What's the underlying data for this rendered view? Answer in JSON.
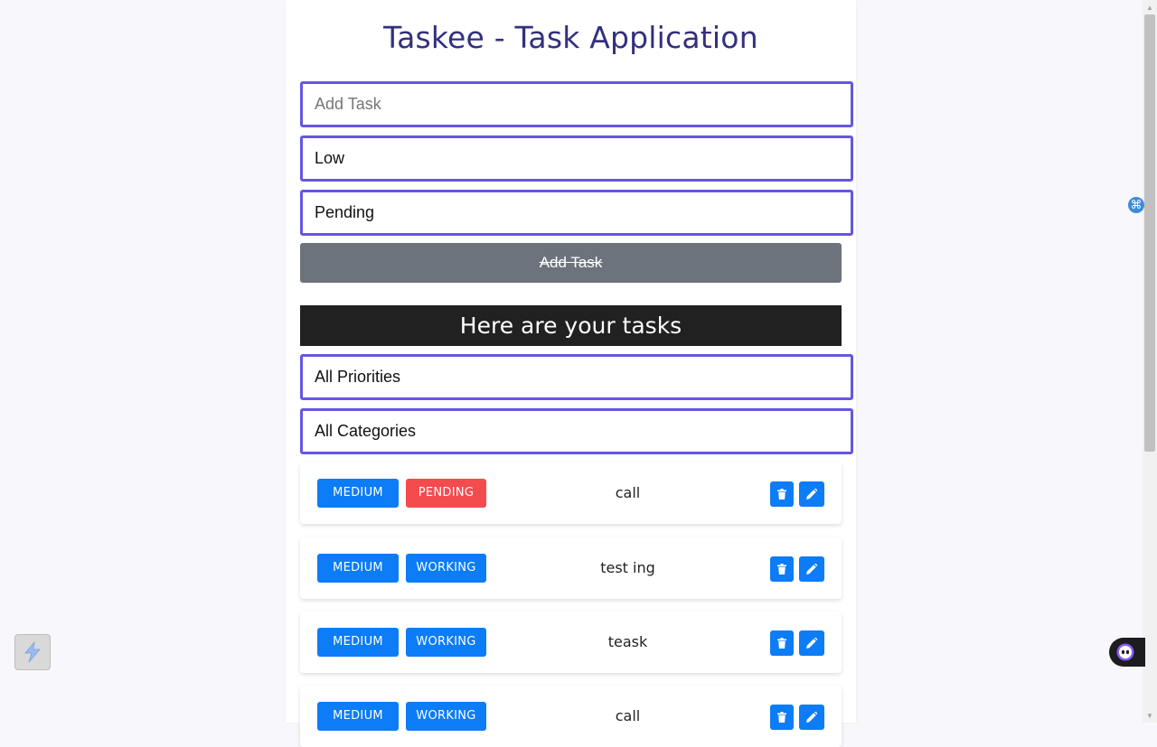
{
  "app": {
    "title": "Taskee - Task Application"
  },
  "form": {
    "task_placeholder": "Add Task",
    "task_value": "",
    "priority_value": "Low",
    "status_value": "Pending",
    "submit_label": "Add Task"
  },
  "list": {
    "header": "Here are your tasks",
    "priority_filter": "All Priorities",
    "category_filter": "All Categories"
  },
  "tasks": [
    {
      "priority": "MEDIUM",
      "status": "PENDING",
      "name": "call"
    },
    {
      "priority": "MEDIUM",
      "status": "WORKING",
      "name": "test ing"
    },
    {
      "priority": "MEDIUM",
      "status": "WORKING",
      "name": "teask"
    },
    {
      "priority": "MEDIUM",
      "status": "WORKING",
      "name": "call"
    }
  ],
  "icons": {
    "delete": "trash-icon",
    "edit": "pencil-icon",
    "side": "command-icon"
  },
  "colors": {
    "title": "#33307e",
    "input_border": "#6656e4",
    "priority_medium": "#0c7cf7",
    "status_pending": "#f44b4e",
    "status_working": "#0c7cf7",
    "submit_button": "#6c737c",
    "list_header": "#212121"
  }
}
